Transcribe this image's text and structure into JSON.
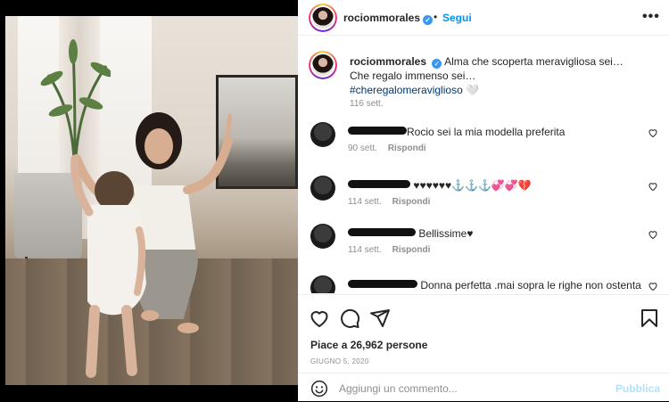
{
  "post": {
    "username": "rociommorales",
    "follow_label": "Segui",
    "separator": "•",
    "verified_glyph": "✓",
    "more_glyph": "•••"
  },
  "caption": {
    "username": "rociommorales",
    "text": "Alma che scoperta meravigliosa sei… Che regalo immenso sei…",
    "hashtag": "#cheregalomeraviglioso",
    "trailing": " 🤍",
    "time": "116 sett."
  },
  "comments": [
    {
      "text": "Rocio sei la mia modella preferita",
      "time": "90 sett.",
      "reply": "Rispondi"
    },
    {
      "text": "♥♥♥♥♥♥⚓⚓⚓💞💞💔",
      "time": "114 sett.",
      "reply": "Rispondi"
    },
    {
      "text": " Bellissime♥",
      "time": "114 sett.",
      "reply": "Rispondi"
    },
    {
      "text": "Donna perfetta .mai sopra le righe non ostenta",
      "time": "",
      "reply": ""
    }
  ],
  "actions": {
    "likes": "Piace a 26,962 persone",
    "date": "GIUGNO 5, 2020"
  },
  "add_comment": {
    "placeholder": "Aggiungi un commento...",
    "publish_label": "Pubblica"
  },
  "icons": {
    "like": "heart-icon",
    "comment": "comment-icon",
    "share": "share-icon",
    "save": "bookmark-icon",
    "emoji": "emoji-icon"
  },
  "colors": {
    "accent": "#0095f6",
    "publish_disabled": "#b2dffc",
    "muted": "#8e8e8e",
    "hashtag": "#00376b"
  }
}
